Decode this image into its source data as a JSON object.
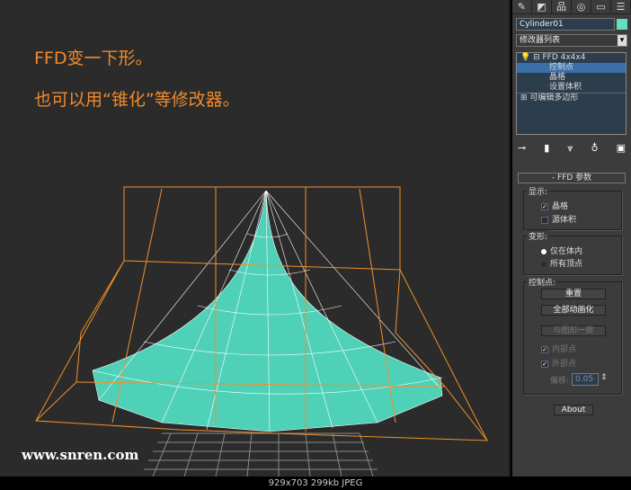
{
  "viewport": {
    "caption1": "FFD变一下形。",
    "caption2": "也可以用“锥化”等修改器。",
    "watermark": "www.snren.com"
  },
  "panel": {
    "tabs": [
      "create-icon",
      "modify-icon",
      "hierarchy-icon",
      "motion-icon",
      "display-icon",
      "utilities-icon"
    ],
    "object_name": "Cylinder01",
    "object_color": "#5fe0c0",
    "modifier_list": "修改器列表",
    "stack": [
      "FFD 4x4x4",
      "控制点",
      "晶格",
      "设置体积",
      "可编辑多边形"
    ],
    "rollout_title": "FFD 参数",
    "display_group": "显示:",
    "lattice": "晶格",
    "source_volume": "源体积",
    "deform_group": "变形:",
    "only_in_volume": "仅在体内",
    "all_vertices": "所有顶点",
    "cp_group": "控制点:",
    "reset": "重置",
    "animate_all": "全部动画化",
    "conform": "与图形一致",
    "inside_points": "内部点",
    "outside_points": "外部点",
    "offset_label": "偏移:",
    "offset_value": "0.05",
    "about": "About"
  },
  "status": "929x703  299kb  JPEG"
}
